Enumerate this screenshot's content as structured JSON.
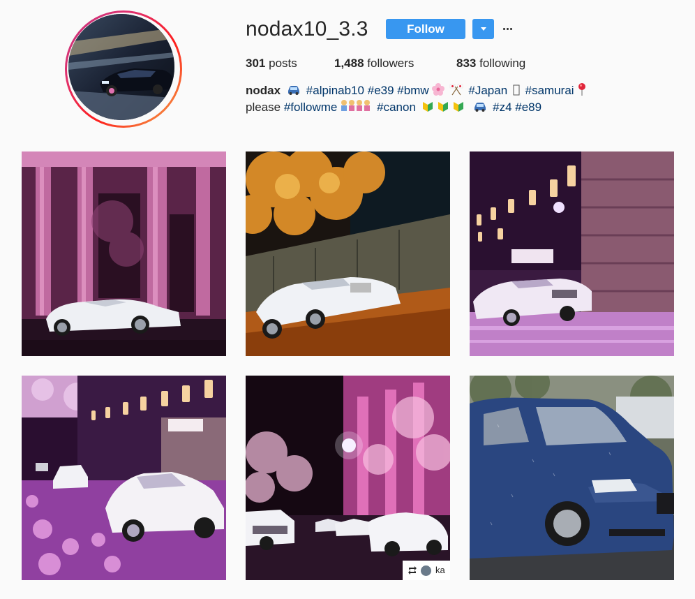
{
  "profile": {
    "username": "nodax10_3.3",
    "follow_label": "Follow",
    "stats": {
      "posts_count": "301",
      "posts_label": "posts",
      "followers_count": "1,488",
      "followers_label": "followers",
      "following_count": "833",
      "following_label": "following"
    },
    "bio": {
      "name": "nodax",
      "line1_tags": [
        "#alpinab10",
        "#e39",
        "#bmw",
        "#Japan",
        "#samurai"
      ],
      "line2_text": "please",
      "line2_tags": [
        "#followme",
        "#canon",
        "#z4",
        "#e89"
      ]
    }
  },
  "posts": [
    {
      "scene": "pink-building-white-roadster"
    },
    {
      "scene": "autumn-tree-white-roadster"
    },
    {
      "scene": "purple-street-lanterns-white-roadster"
    },
    {
      "scene": "cherry-blossom-alley-white-cars"
    },
    {
      "scene": "night-cherry-trees-lineup",
      "regram_user": "ka"
    },
    {
      "scene": "blue-hatchback-rain"
    }
  ],
  "colors": {
    "follow_button": "#3897f0",
    "hashtag": "#003569",
    "background": "#fafafa"
  },
  "icons": [
    "caret-down-icon",
    "more-icon",
    "car-emoji-icon",
    "cherry-blossom-emoji-icon",
    "crossed-flags-emoji-icon",
    "pin-emoji-icon",
    "people-emoji-icon",
    "beginner-emoji-icon",
    "regram-icon"
  ]
}
